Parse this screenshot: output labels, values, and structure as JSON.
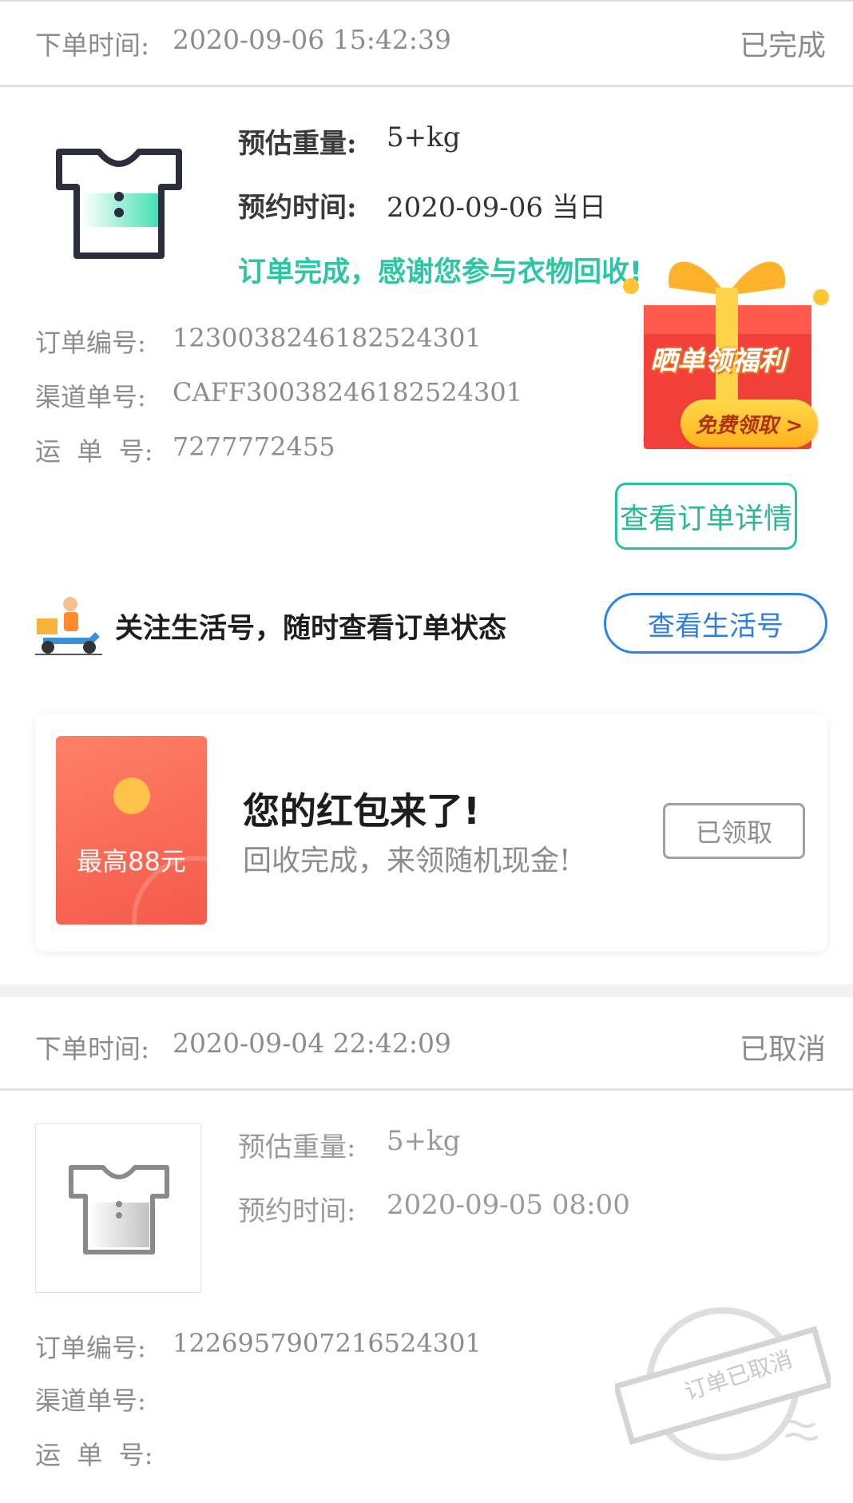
{
  "order1": {
    "order_time_label": "下单时间:",
    "order_time_value": "2020-09-06 15:42:39",
    "status": "已完成",
    "weight_label": "预估重量:",
    "weight_value": "5+kg",
    "appt_label": "预约时间:",
    "appt_value": "2020-09-06 当日",
    "complete_message": "订单完成，感谢您参与衣物回收!",
    "order_no_label": "订单编号:",
    "order_no_value": "1230038246182524301",
    "channel_no_label": "渠道单号:",
    "channel_no_value": "CAFF30038246182524301",
    "waybill_label": "运  单  号:",
    "waybill_value": "7277772455",
    "detail_button": "查看订单详情",
    "promo_title": "晒单领福利",
    "promo_button": "免费领取 >"
  },
  "follow": {
    "text": "关注生活号，随时查看订单状态",
    "button": "查看生活号"
  },
  "redpacket_card": {
    "badge": "最高88元",
    "title": "您的红包来了!",
    "subtitle": "回收完成，来领随机现金!",
    "button": "已领取"
  },
  "order2": {
    "order_time_label": "下单时间:",
    "order_time_value": "2020-09-04 22:42:09",
    "status": "已取消",
    "weight_label": "预估重量:",
    "weight_value": "5+kg",
    "appt_label": "预约时间:",
    "appt_value": "2020-09-05 08:00",
    "order_no_label": "订单编号:",
    "order_no_value": "1226957907216524301",
    "channel_no_label": "渠道单号:",
    "channel_no_value": "",
    "waybill_label": "运  单  号:",
    "waybill_value": "",
    "stamp": "订单已取消"
  },
  "colors": {
    "accent_green": "#26c2a0",
    "accent_blue": "#2e83e6",
    "red_packet": "#f55a4a"
  }
}
